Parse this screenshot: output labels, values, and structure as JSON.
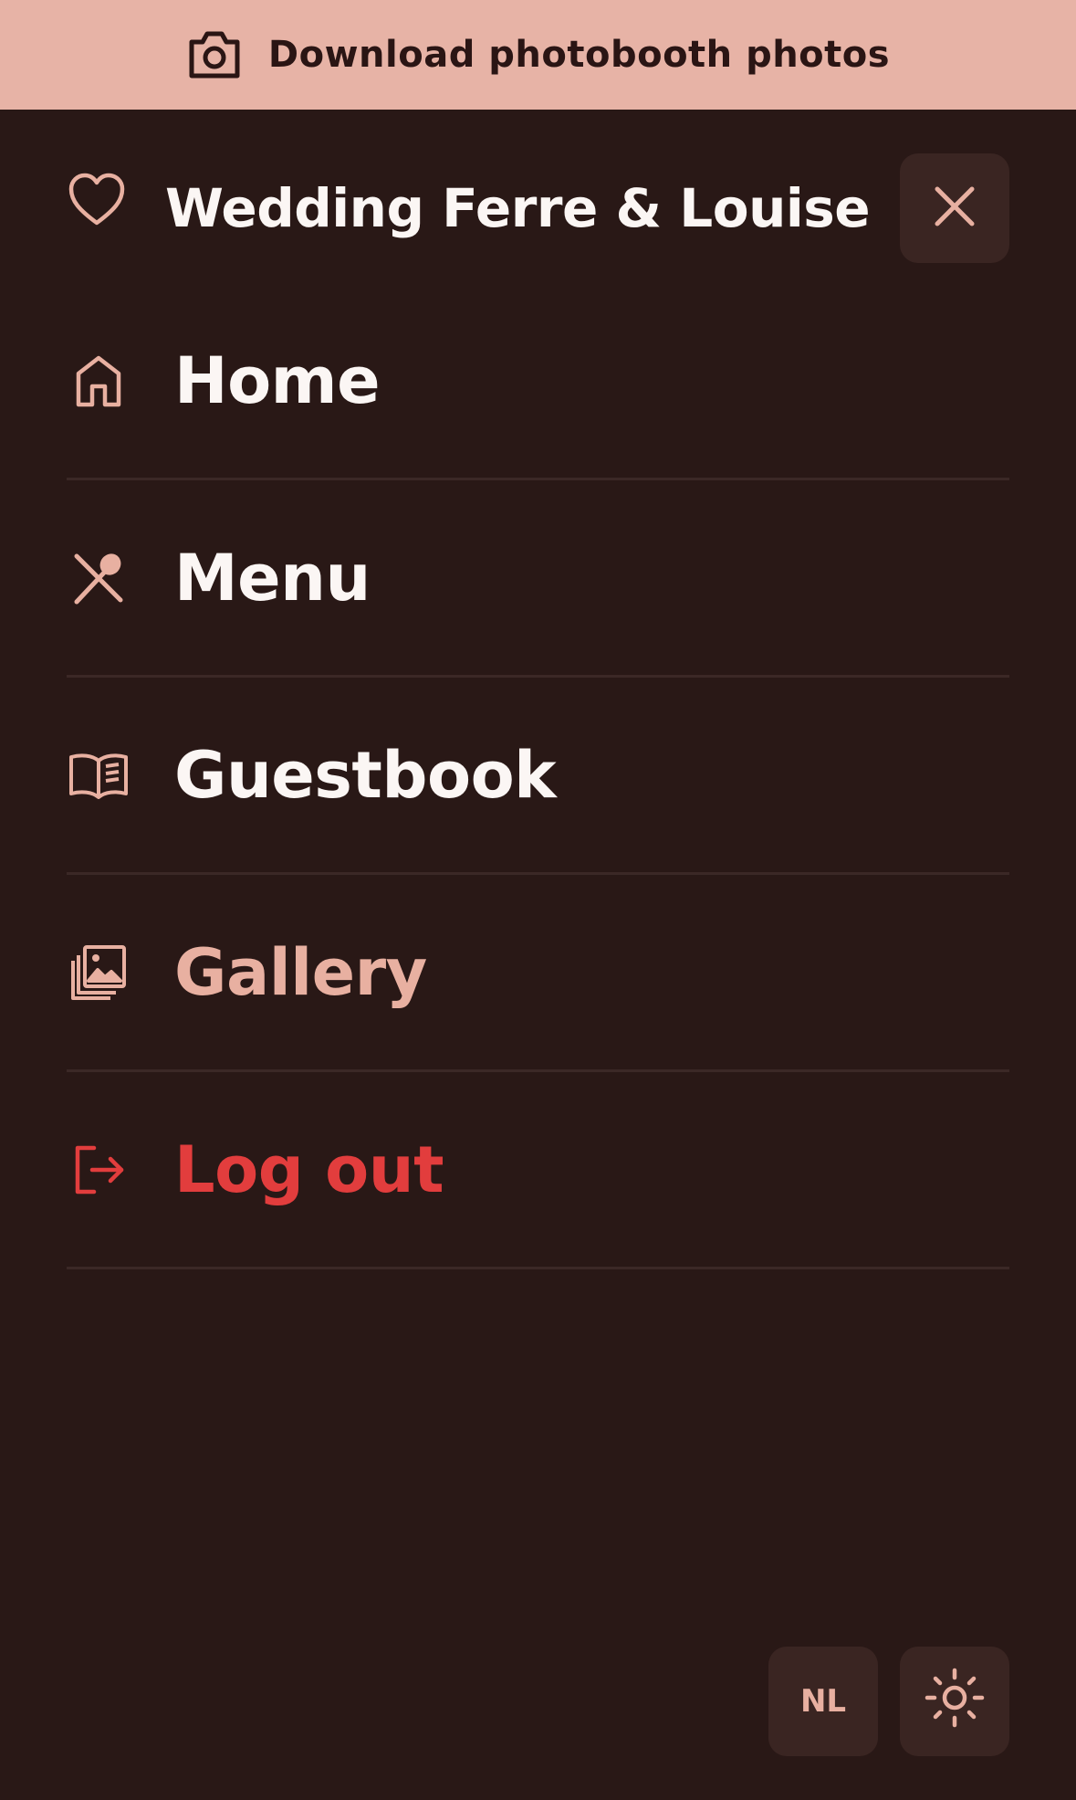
{
  "banner": {
    "label": "Download photobooth photos",
    "icon": "camera-icon"
  },
  "header": {
    "title": "Wedding Ferre & Louise",
    "icon": "heart-icon",
    "close_icon": "close-icon"
  },
  "nav": {
    "items": [
      {
        "label": "Home",
        "icon": "home-icon",
        "active": false
      },
      {
        "label": "Menu",
        "icon": "utensils-icon",
        "active": false
      },
      {
        "label": "Guestbook",
        "icon": "book-icon",
        "active": false
      },
      {
        "label": "Gallery",
        "icon": "gallery-icon",
        "active": true
      },
      {
        "label": "Log out",
        "icon": "logout-icon",
        "active": false
      }
    ]
  },
  "controls": {
    "language": "NL",
    "theme_icon": "sun-icon"
  },
  "colors": {
    "background": "#291816",
    "banner": "#e7b3a6",
    "accent": "#e8b0a1",
    "danger": "#e23d3d",
    "text": "#fbf6f4",
    "button_bg": "#3a2522"
  }
}
